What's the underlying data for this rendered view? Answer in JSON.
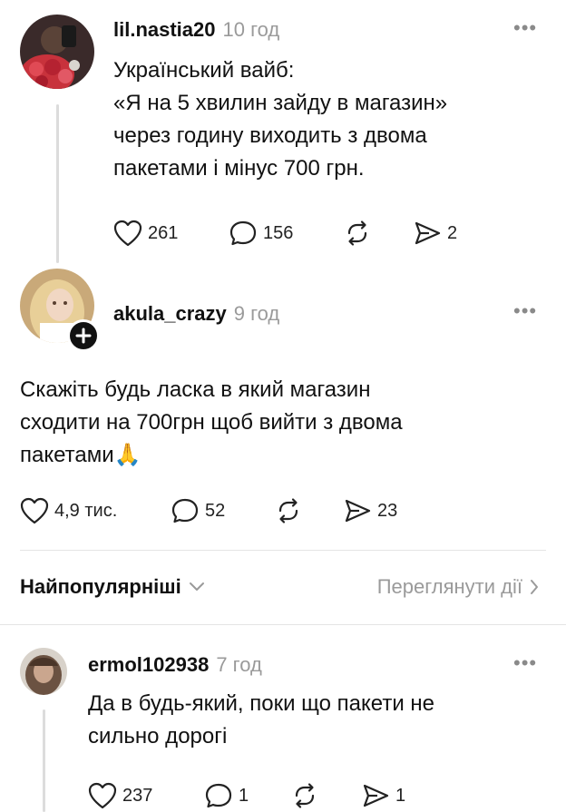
{
  "posts": [
    {
      "username": "lil.nastia20",
      "time": "10 год",
      "text": "Український вайб:\n«Я на 5 хвилин зайду в магазин»\nчерез годину виходить з двома\nпакетами і мінус 700 грн.",
      "likes": "261",
      "comments": "156",
      "shares": "2"
    },
    {
      "username": "akula_crazy",
      "time": "9 год",
      "text": "Скажіть будь ласка в який магазин\nсходити на 700грн щоб вийти з двома\nпакетами🙏",
      "likes": "4,9 тис.",
      "comments": "52",
      "shares": "23"
    }
  ],
  "sort": {
    "label": "Найпопулярніші",
    "activity_link": "Переглянути дії"
  },
  "reply": {
    "username": "ermol102938",
    "time": "7 год",
    "text": "Да в будь-який, поки що пакети не\nсильно дорогі",
    "likes": "237",
    "comments": "1",
    "shares": "1"
  },
  "icons": {
    "more": "more-horizontal-icon",
    "like": "heart-icon",
    "comment": "comment-bubble-icon",
    "repost": "repost-icon",
    "share": "send-icon",
    "follow": "plus-icon",
    "chevron": "chevron-down-icon"
  }
}
